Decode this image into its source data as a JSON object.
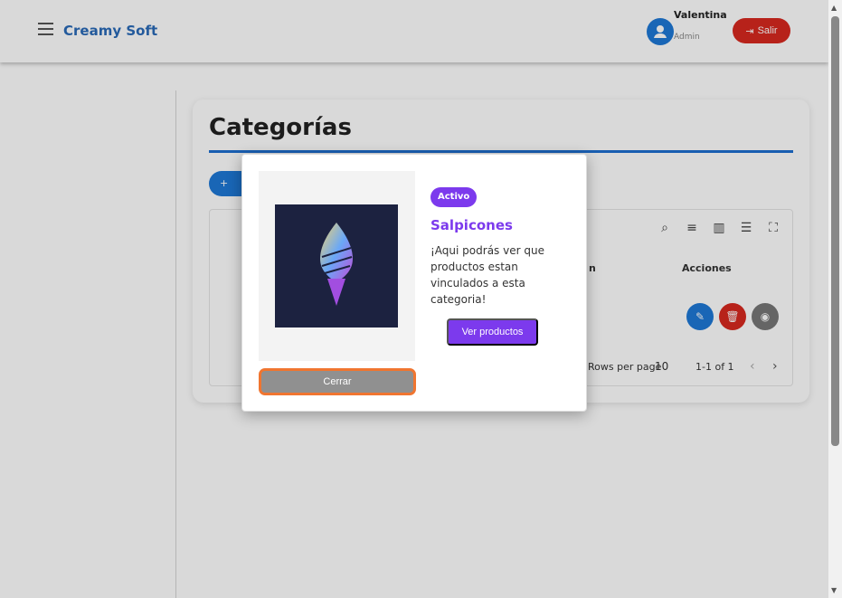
{
  "header": {
    "brand": "Creamy Soft",
    "user_name": "Valentina",
    "user_role": "Admin",
    "logout_label": "Salir"
  },
  "page": {
    "title": "Categorías",
    "add_label": "+ Agregar",
    "table": {
      "visible_headers": [
        "n",
        "Acciones"
      ],
      "rows_per_page_label": "Rows per page",
      "rows_per_page_value": "10",
      "pagination": "1-1 of 1"
    }
  },
  "modal": {
    "status": "Activo",
    "category_name": "Salpicones",
    "description": "¡Aqui podrás ver que productos estan vinculados a esta categoria!",
    "view_label": "Ver productos",
    "close_label": "Cerrar"
  },
  "colors": {
    "brand": "#2a6ab8",
    "accent_purple": "#7c3aed",
    "logout_red": "#d8281f",
    "focus_orange": "#f07530"
  }
}
